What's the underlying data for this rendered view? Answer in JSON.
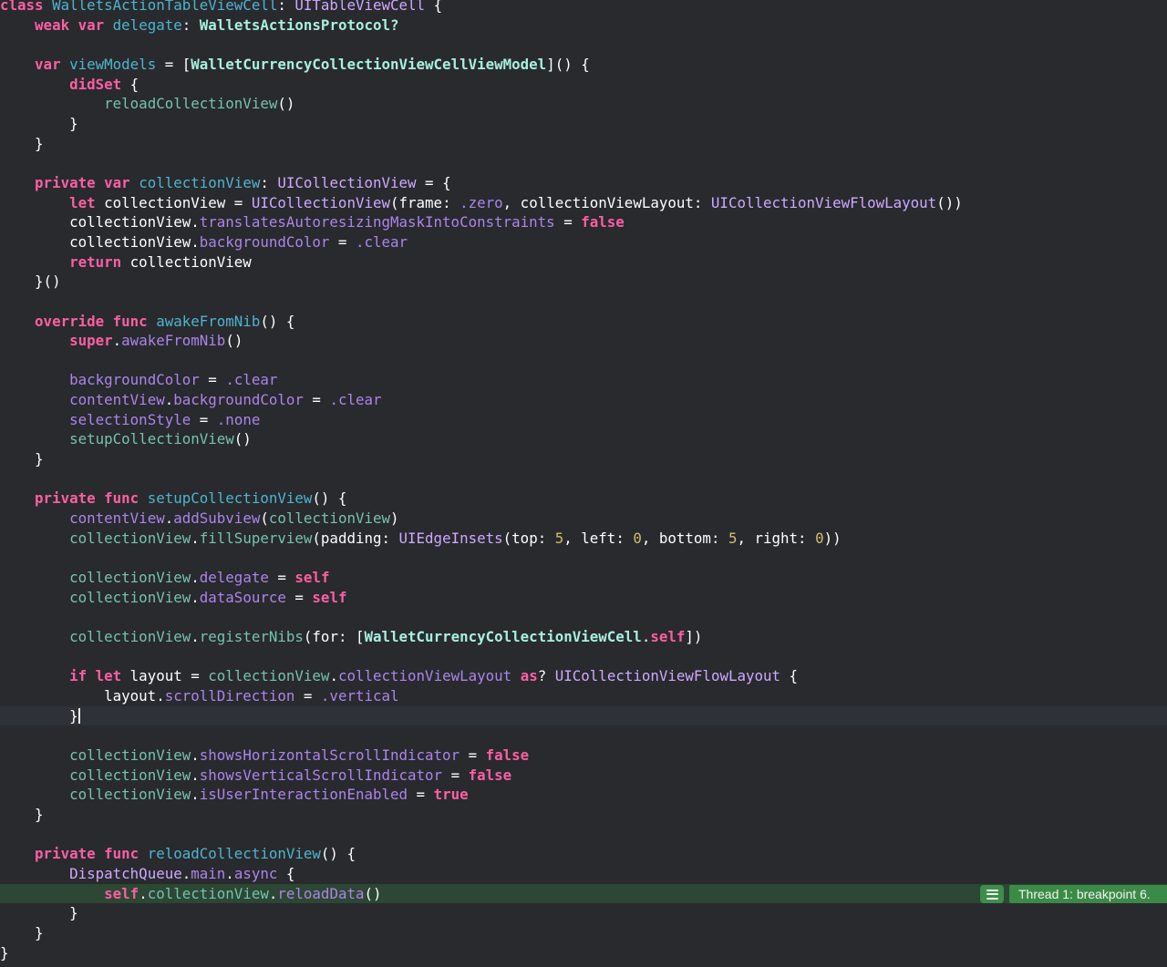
{
  "editor": {
    "language": "swift",
    "colors": {
      "bg": "#282a2e",
      "currentLine": "#2e3138",
      "breakpointLine": "#2c4733",
      "badge": "#3f8d4a",
      "banner": "#3c8a47",
      "bannerText": "#eef6ee",
      "caret": "#f5f5f7",
      "kw": "#fc5fa3",
      "pl": "#ffffff",
      "de": "#4fb4cf",
      "pt": "#a9efe0",
      "st": "#d0a8ff",
      "pm": "#77c1b0",
      "sm": "#ad84ea",
      "nu": "#d0bf69"
    },
    "cursor": {
      "line": 37,
      "ch": 9
    },
    "breakpoint": {
      "line": 46,
      "icon": "hamburger-menu-icon",
      "label": "Thread 1: breakpoint 6."
    },
    "lines": [
      {
        "tokens": [
          [
            "kw",
            "class "
          ],
          [
            "de",
            "WalletsActionTableViewCell"
          ],
          [
            "pl",
            ": "
          ],
          [
            "st",
            "UITableViewCell"
          ],
          [
            "pl",
            " {"
          ]
        ]
      },
      {
        "tokens": [
          [
            "pl",
            "    "
          ],
          [
            "kw",
            "weak var "
          ],
          [
            "de",
            "delegate"
          ],
          [
            "pl",
            ": "
          ],
          [
            "pt",
            "WalletsActionsProtocol?"
          ]
        ]
      },
      {
        "tokens": []
      },
      {
        "tokens": [
          [
            "pl",
            "    "
          ],
          [
            "kw",
            "var "
          ],
          [
            "de",
            "viewModels"
          ],
          [
            "pl",
            " = ["
          ],
          [
            "pt",
            "WalletCurrencyCollectionViewCellViewModel"
          ],
          [
            "pl",
            "]() {"
          ]
        ]
      },
      {
        "tokens": [
          [
            "pl",
            "        "
          ],
          [
            "kw",
            "didSet"
          ],
          [
            "pl",
            " {"
          ]
        ]
      },
      {
        "tokens": [
          [
            "pl",
            "            "
          ],
          [
            "pm",
            "reloadCollectionView"
          ],
          [
            "pl",
            "()"
          ]
        ]
      },
      {
        "tokens": [
          [
            "pl",
            "        }"
          ]
        ]
      },
      {
        "tokens": [
          [
            "pl",
            "    }"
          ]
        ]
      },
      {
        "tokens": []
      },
      {
        "tokens": [
          [
            "pl",
            "    "
          ],
          [
            "kw",
            "private var "
          ],
          [
            "de",
            "collectionView"
          ],
          [
            "pl",
            ": "
          ],
          [
            "st",
            "UICollectionView"
          ],
          [
            "pl",
            " = {"
          ]
        ]
      },
      {
        "tokens": [
          [
            "pl",
            "        "
          ],
          [
            "kw",
            "let "
          ],
          [
            "pl",
            "collectionView = "
          ],
          [
            "st",
            "UICollectionView"
          ],
          [
            "pl",
            "(frame: "
          ],
          [
            "sm",
            ".zero"
          ],
          [
            "pl",
            ", collectionViewLayout: "
          ],
          [
            "st",
            "UICollectionViewFlowLayout"
          ],
          [
            "pl",
            "())"
          ]
        ]
      },
      {
        "tokens": [
          [
            "pl",
            "        collectionView."
          ],
          [
            "sm",
            "translatesAutoresizingMaskIntoConstraints"
          ],
          [
            "pl",
            " = "
          ],
          [
            "kw",
            "false"
          ]
        ]
      },
      {
        "tokens": [
          [
            "pl",
            "        collectionView."
          ],
          [
            "sm",
            "backgroundColor"
          ],
          [
            "pl",
            " = "
          ],
          [
            "sm",
            ".clear"
          ]
        ]
      },
      {
        "tokens": [
          [
            "pl",
            "        "
          ],
          [
            "kw",
            "return "
          ],
          [
            "pl",
            "collectionView"
          ]
        ]
      },
      {
        "tokens": [
          [
            "pl",
            "    }()"
          ]
        ]
      },
      {
        "tokens": []
      },
      {
        "tokens": [
          [
            "pl",
            "    "
          ],
          [
            "kw",
            "override func "
          ],
          [
            "de",
            "awakeFromNib"
          ],
          [
            "pl",
            "() {"
          ]
        ]
      },
      {
        "tokens": [
          [
            "pl",
            "        "
          ],
          [
            "kw",
            "super"
          ],
          [
            "pl",
            "."
          ],
          [
            "sm",
            "awakeFromNib"
          ],
          [
            "pl",
            "()"
          ]
        ]
      },
      {
        "tokens": []
      },
      {
        "tokens": [
          [
            "pl",
            "        "
          ],
          [
            "sm",
            "backgroundColor"
          ],
          [
            "pl",
            " = "
          ],
          [
            "sm",
            ".clear"
          ]
        ]
      },
      {
        "tokens": [
          [
            "pl",
            "        "
          ],
          [
            "sm",
            "contentView"
          ],
          [
            "pl",
            "."
          ],
          [
            "sm",
            "backgroundColor"
          ],
          [
            "pl",
            " = "
          ],
          [
            "sm",
            ".clear"
          ]
        ]
      },
      {
        "tokens": [
          [
            "pl",
            "        "
          ],
          [
            "sm",
            "selectionStyle"
          ],
          [
            "pl",
            " = "
          ],
          [
            "sm",
            ".none"
          ]
        ]
      },
      {
        "tokens": [
          [
            "pl",
            "        "
          ],
          [
            "pm",
            "setupCollectionView"
          ],
          [
            "pl",
            "()"
          ]
        ]
      },
      {
        "tokens": [
          [
            "pl",
            "    }"
          ]
        ]
      },
      {
        "tokens": []
      },
      {
        "tokens": [
          [
            "pl",
            "    "
          ],
          [
            "kw",
            "private func "
          ],
          [
            "de",
            "setupCollectionView"
          ],
          [
            "pl",
            "() {"
          ]
        ]
      },
      {
        "tokens": [
          [
            "pl",
            "        "
          ],
          [
            "sm",
            "contentView"
          ],
          [
            "pl",
            "."
          ],
          [
            "sm",
            "addSubview"
          ],
          [
            "pl",
            "("
          ],
          [
            "pm",
            "collectionView"
          ],
          [
            "pl",
            ")"
          ]
        ]
      },
      {
        "tokens": [
          [
            "pl",
            "        "
          ],
          [
            "pm",
            "collectionView"
          ],
          [
            "pl",
            "."
          ],
          [
            "pm",
            "fillSuperview"
          ],
          [
            "pl",
            "(padding: "
          ],
          [
            "st",
            "UIEdgeInsets"
          ],
          [
            "pl",
            "(top: "
          ],
          [
            "nu",
            "5"
          ],
          [
            "pl",
            ", left: "
          ],
          [
            "nu",
            "0"
          ],
          [
            "pl",
            ", bottom: "
          ],
          [
            "nu",
            "5"
          ],
          [
            "pl",
            ", right: "
          ],
          [
            "nu",
            "0"
          ],
          [
            "pl",
            "))"
          ]
        ]
      },
      {
        "tokens": []
      },
      {
        "tokens": [
          [
            "pl",
            "        "
          ],
          [
            "pm",
            "collectionView"
          ],
          [
            "pl",
            "."
          ],
          [
            "sm",
            "delegate"
          ],
          [
            "pl",
            " = "
          ],
          [
            "kw",
            "self"
          ]
        ]
      },
      {
        "tokens": [
          [
            "pl",
            "        "
          ],
          [
            "pm",
            "collectionView"
          ],
          [
            "pl",
            "."
          ],
          [
            "sm",
            "dataSource"
          ],
          [
            "pl",
            " = "
          ],
          [
            "kw",
            "self"
          ]
        ]
      },
      {
        "tokens": []
      },
      {
        "tokens": [
          [
            "pl",
            "        "
          ],
          [
            "pm",
            "collectionView"
          ],
          [
            "pl",
            "."
          ],
          [
            "pm",
            "registerNibs"
          ],
          [
            "pl",
            "(for: ["
          ],
          [
            "pt",
            "WalletCurrencyCollectionViewCell"
          ],
          [
            "pl",
            "."
          ],
          [
            "kw",
            "self"
          ],
          [
            "pl",
            "])"
          ]
        ]
      },
      {
        "tokens": []
      },
      {
        "tokens": [
          [
            "pl",
            "        "
          ],
          [
            "kw",
            "if let "
          ],
          [
            "pl",
            "layout = "
          ],
          [
            "pm",
            "collectionView"
          ],
          [
            "pl",
            "."
          ],
          [
            "sm",
            "collectionViewLayout"
          ],
          [
            "pl",
            " "
          ],
          [
            "kw",
            "as"
          ],
          [
            "pl",
            "? "
          ],
          [
            "st",
            "UICollectionViewFlowLayout"
          ],
          [
            "pl",
            " {"
          ]
        ]
      },
      {
        "tokens": [
          [
            "pl",
            "            layout."
          ],
          [
            "sm",
            "scrollDirection"
          ],
          [
            "pl",
            " = "
          ],
          [
            "sm",
            ".vertical"
          ]
        ]
      },
      {
        "tokens": [
          [
            "pl",
            "        }"
          ]
        ],
        "mark": "current"
      },
      {
        "tokens": []
      },
      {
        "tokens": [
          [
            "pl",
            "        "
          ],
          [
            "pm",
            "collectionView"
          ],
          [
            "pl",
            "."
          ],
          [
            "sm",
            "showsHorizontalScrollIndicator"
          ],
          [
            "pl",
            " = "
          ],
          [
            "kw",
            "false"
          ]
        ]
      },
      {
        "tokens": [
          [
            "pl",
            "        "
          ],
          [
            "pm",
            "collectionView"
          ],
          [
            "pl",
            "."
          ],
          [
            "sm",
            "showsVerticalScrollIndicator"
          ],
          [
            "pl",
            " = "
          ],
          [
            "kw",
            "false"
          ]
        ]
      },
      {
        "tokens": [
          [
            "pl",
            "        "
          ],
          [
            "pm",
            "collectionView"
          ],
          [
            "pl",
            "."
          ],
          [
            "sm",
            "isUserInteractionEnabled"
          ],
          [
            "pl",
            " = "
          ],
          [
            "kw",
            "true"
          ]
        ]
      },
      {
        "tokens": [
          [
            "pl",
            "    }"
          ]
        ]
      },
      {
        "tokens": []
      },
      {
        "tokens": [
          [
            "pl",
            "    "
          ],
          [
            "kw",
            "private func "
          ],
          [
            "de",
            "reloadCollectionView"
          ],
          [
            "pl",
            "() {"
          ]
        ]
      },
      {
        "tokens": [
          [
            "pl",
            "        "
          ],
          [
            "st",
            "DispatchQueue"
          ],
          [
            "pl",
            "."
          ],
          [
            "sm",
            "main"
          ],
          [
            "pl",
            "."
          ],
          [
            "sm",
            "async"
          ],
          [
            "pl",
            " {"
          ]
        ]
      },
      {
        "tokens": [
          [
            "pl",
            "            "
          ],
          [
            "kw",
            "self"
          ],
          [
            "pl",
            "."
          ],
          [
            "pm",
            "collectionView"
          ],
          [
            "pl",
            "."
          ],
          [
            "sm",
            "reloadData"
          ],
          [
            "pl",
            "()"
          ]
        ],
        "mark": "breakpoint"
      },
      {
        "tokens": [
          [
            "pl",
            "        }"
          ]
        ]
      },
      {
        "tokens": [
          [
            "pl",
            "    }"
          ]
        ]
      },
      {
        "tokens": [
          [
            "pl",
            "}"
          ]
        ]
      }
    ]
  }
}
